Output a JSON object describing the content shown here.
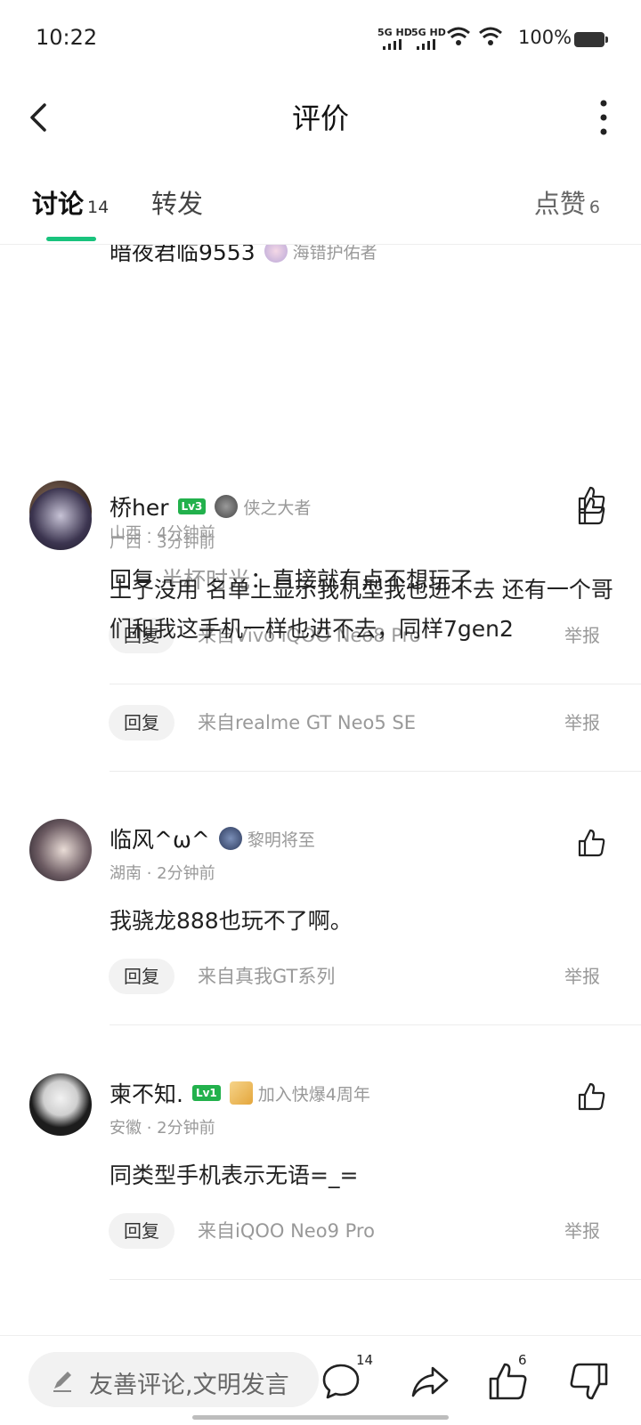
{
  "status_bar": {
    "time": "10:22",
    "signal1": "5G HD",
    "signal2": "5G HD",
    "battery": "100%"
  },
  "header": {
    "title": "评价"
  },
  "tabs": {
    "discussion": {
      "label": "讨论",
      "count": "14"
    },
    "forward": {
      "label": "转发"
    },
    "likes": {
      "label": "点赞",
      "count": "6"
    }
  },
  "comments": [
    {
      "name": "暗夜君临9553",
      "level": "",
      "badge": "海错护佑者",
      "meta": "山西 · 4分钟前",
      "reply_to": "半杯时光",
      "reply_prefix": "回复",
      "reply_sep": "：",
      "text": "直接就有点不想玩了",
      "reply_label": "回复",
      "device": "来自Vivo iQOO Neo8 Pro",
      "report_label": "举报"
    },
    {
      "name": "桥her",
      "level": "Lv3",
      "badge": "侠之大者",
      "meta": "广西 · 3分钟前",
      "text": "上了没用 名单上显示我机型我也进不去 还有一个哥们和我这手机一样也进不去，同样7gen2",
      "reply_label": "回复",
      "device": "来自realme GT Neo5 SE",
      "report_label": "举报"
    },
    {
      "name": "临风^ω^",
      "level": "",
      "badge": "黎明将至",
      "meta": "湖南 · 2分钟前",
      "text": "我骁龙888也玩不了啊。",
      "reply_label": "回复",
      "device": "来自真我GT系列",
      "report_label": "举报"
    },
    {
      "name": "柬不知.",
      "level": "Lv1",
      "badge": "加入快爆4周年",
      "meta": "安徽 · 2分钟前",
      "text": "同类型手机表示无语=_=",
      "reply_label": "回复",
      "device": "来自iQOO Neo9 Pro",
      "report_label": "举报"
    }
  ],
  "bottom_bar": {
    "placeholder": "友善评论,文明发言",
    "comment_count": "14",
    "like_count": "6"
  },
  "colors": {
    "accent": "#19c37d",
    "level_badge": "#22b14c",
    "muted_text": "#999999"
  }
}
